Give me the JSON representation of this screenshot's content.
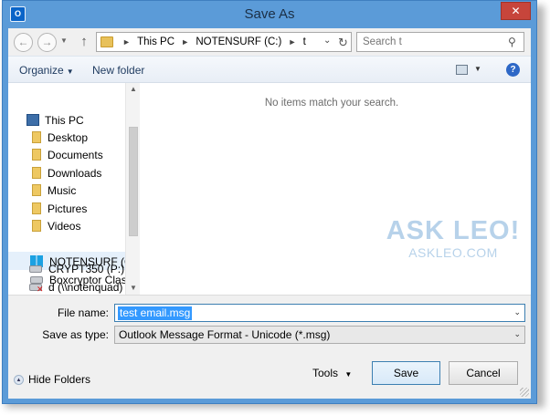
{
  "window": {
    "title": "Save As",
    "close_label": "✕",
    "app_icon_label": "O"
  },
  "address_bar": {
    "breadcrumbs": [
      "This PC",
      "NOTENSURF (C:)",
      "t"
    ],
    "search_placeholder": "Search t"
  },
  "toolbar": {
    "organize_label": "Organize",
    "new_folder_label": "New folder",
    "help_label": "?"
  },
  "nav_tree": {
    "items": [
      {
        "label": "This PC",
        "icon": "computer-icon"
      },
      {
        "label": "Desktop",
        "icon": "folder-icon"
      },
      {
        "label": "Documents",
        "icon": "folder-icon"
      },
      {
        "label": "Downloads",
        "icon": "folder-icon"
      },
      {
        "label": "Music",
        "icon": "folder-icon"
      },
      {
        "label": "Pictures",
        "icon": "folder-icon"
      },
      {
        "label": "Videos",
        "icon": "folder-icon"
      },
      {
        "label": "NOTENSURF (C:)",
        "icon": "windows-drive-icon"
      },
      {
        "label": "Boxcryptor Classic",
        "icon": "drive-icon"
      },
      {
        "label": "CRYPT350 (P:)",
        "icon": "drive-icon"
      },
      {
        "label": "d (\\\\notenquad) (Z",
        "icon": "network-drive-disconnected-icon"
      }
    ],
    "selected_index": 7
  },
  "content": {
    "empty_message": "No items match your search."
  },
  "watermark": {
    "main": "ASK LEO!",
    "sub": "ASKLEO.COM"
  },
  "form": {
    "file_name_label": "File name:",
    "file_name_value": "test email.msg",
    "save_as_type_label": "Save as type:",
    "save_as_type_value": "Outlook Message Format - Unicode (*.msg)"
  },
  "footer": {
    "hide_folders_label": "Hide Folders",
    "tools_label": "Tools",
    "save_label": "Save",
    "cancel_label": "Cancel"
  },
  "colors": {
    "title_bar": "#5b9bd8",
    "close_button": "#c7453b",
    "selection": "#3399ff",
    "watermark": "#b7d2ea"
  }
}
